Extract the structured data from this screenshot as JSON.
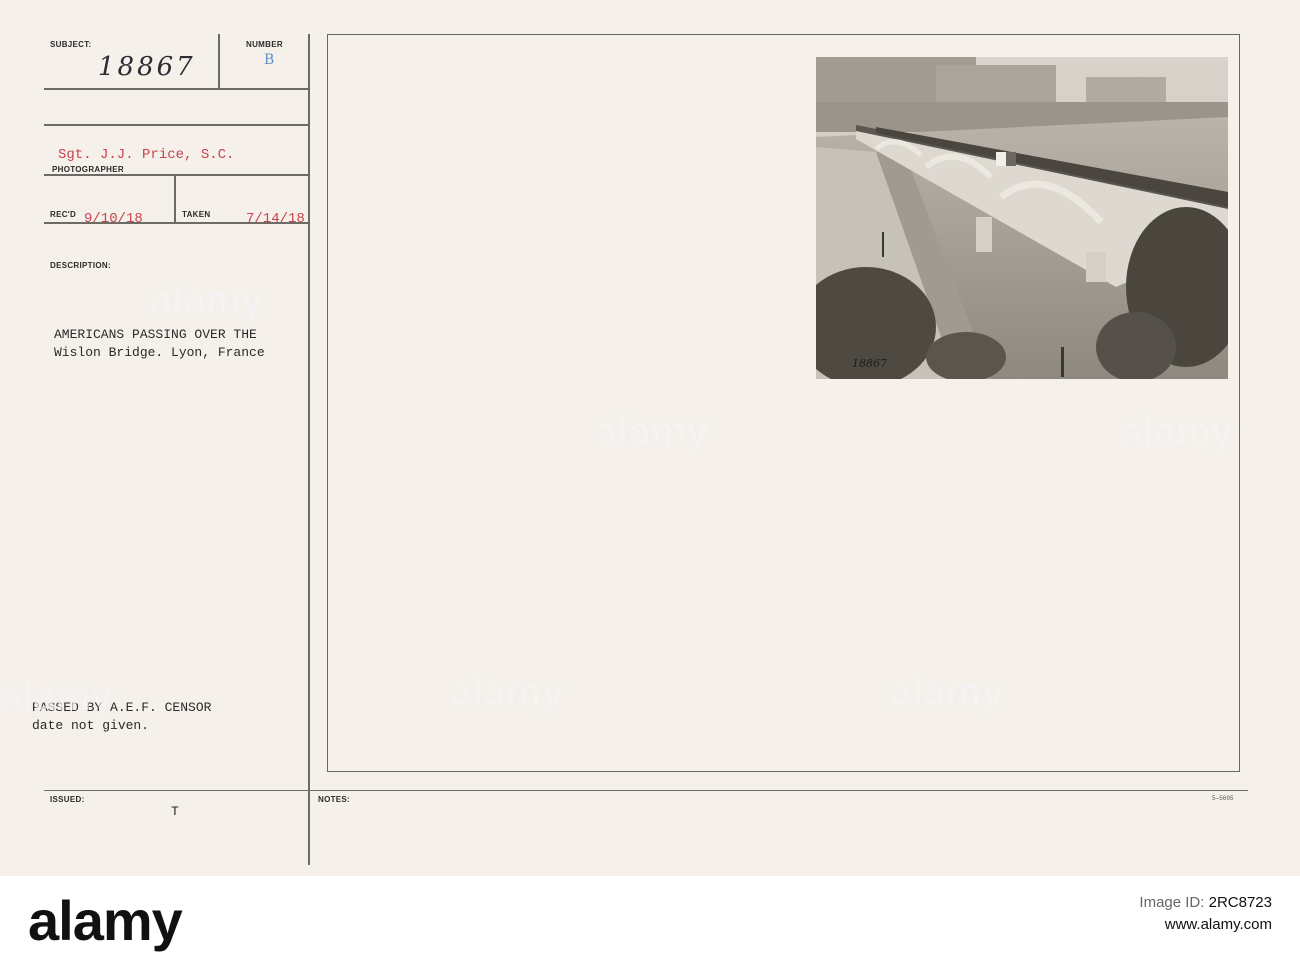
{
  "card": {
    "labels": {
      "subject": "SUBJECT:",
      "number": "NUMBER",
      "photographer": "PHOTOGRAPHER",
      "recd": "REC'D",
      "taken": "TAKEN",
      "description": "DESCRIPTION:",
      "issued": "ISSUED:",
      "notes": "NOTES:"
    },
    "subject_number": "18867",
    "number_stamp": "B",
    "photographer": "Sgt. J.J. Price, S.C.",
    "recd_date": "9/10/18",
    "taken_date": "7/14/18",
    "description_lines": [
      "AMERICANS PASSING OVER THE",
      "Wislon Bridge.  Lyon, France"
    ],
    "censor_lines": [
      "PASSED BY A.E.F. CENSOR",
      "date not given."
    ],
    "issued_mark": "T",
    "form_code": "5—5605",
    "photo_caption_number": "18867",
    "photo_subject": "Bridge crowded with people over river, Lyon"
  },
  "watermarks": [
    "alamy",
    "alamy",
    "alamy",
    "alamy",
    "alamy",
    "alamy"
  ],
  "footer": {
    "logo": "alamy",
    "image_id_label": "Image ID:",
    "image_id": "2RC8723",
    "site": "www.alamy.com"
  },
  "colors": {
    "card_bg": "#f5f1ea",
    "stamp_red": "#c8434f",
    "stamp_blue": "#5a8fc8",
    "rule": "#6e6a66"
  }
}
